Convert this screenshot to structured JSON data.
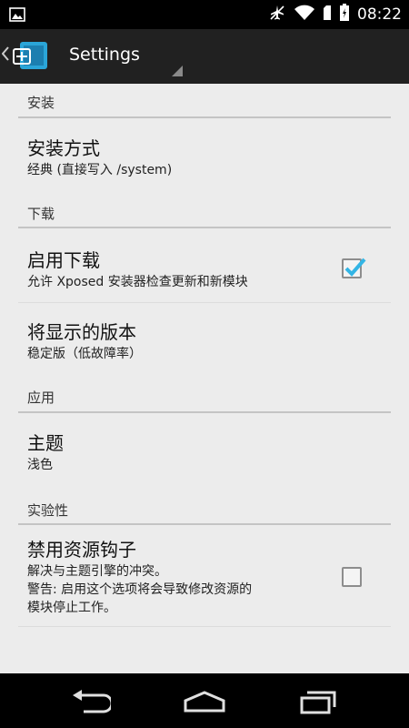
{
  "status_bar": {
    "time": "08:22",
    "icons": [
      "image-icon",
      "airplane-mode-icon",
      "wifi-icon",
      "sim-card-icon",
      "battery-icon"
    ]
  },
  "action_bar": {
    "title": "Settings",
    "icon": "xposed-app-icon"
  },
  "categories": {
    "install": "安装",
    "download": "下载",
    "app": "应用",
    "experimental": "实验性"
  },
  "preferences": {
    "install_method": {
      "title": "安装方式",
      "summary": "经典 (直接写入 /system)"
    },
    "enable_downloads": {
      "title": "启用下载",
      "summary": "允许 Xposed 安装器检查更新和新模块",
      "checked": true
    },
    "version_shown": {
      "title": "将显示的版本",
      "summary": "稳定版（低故障率）"
    },
    "theme": {
      "title": "主题",
      "summary": "浅色"
    },
    "disable_resources": {
      "title": "禁用资源钩子",
      "summary_line1": "解决与主题引擎的冲突。",
      "summary_line2": "警告: 启用这个选项将会导致修改资源的",
      "summary_line3": "模块停止工作。",
      "checked": false
    }
  },
  "colors": {
    "checkbox_accent": "#33b5e5",
    "action_bar": "#212121",
    "background": "#ececec"
  },
  "nav_bar": {
    "buttons": [
      "back-icon",
      "home-icon",
      "recents-icon"
    ]
  }
}
